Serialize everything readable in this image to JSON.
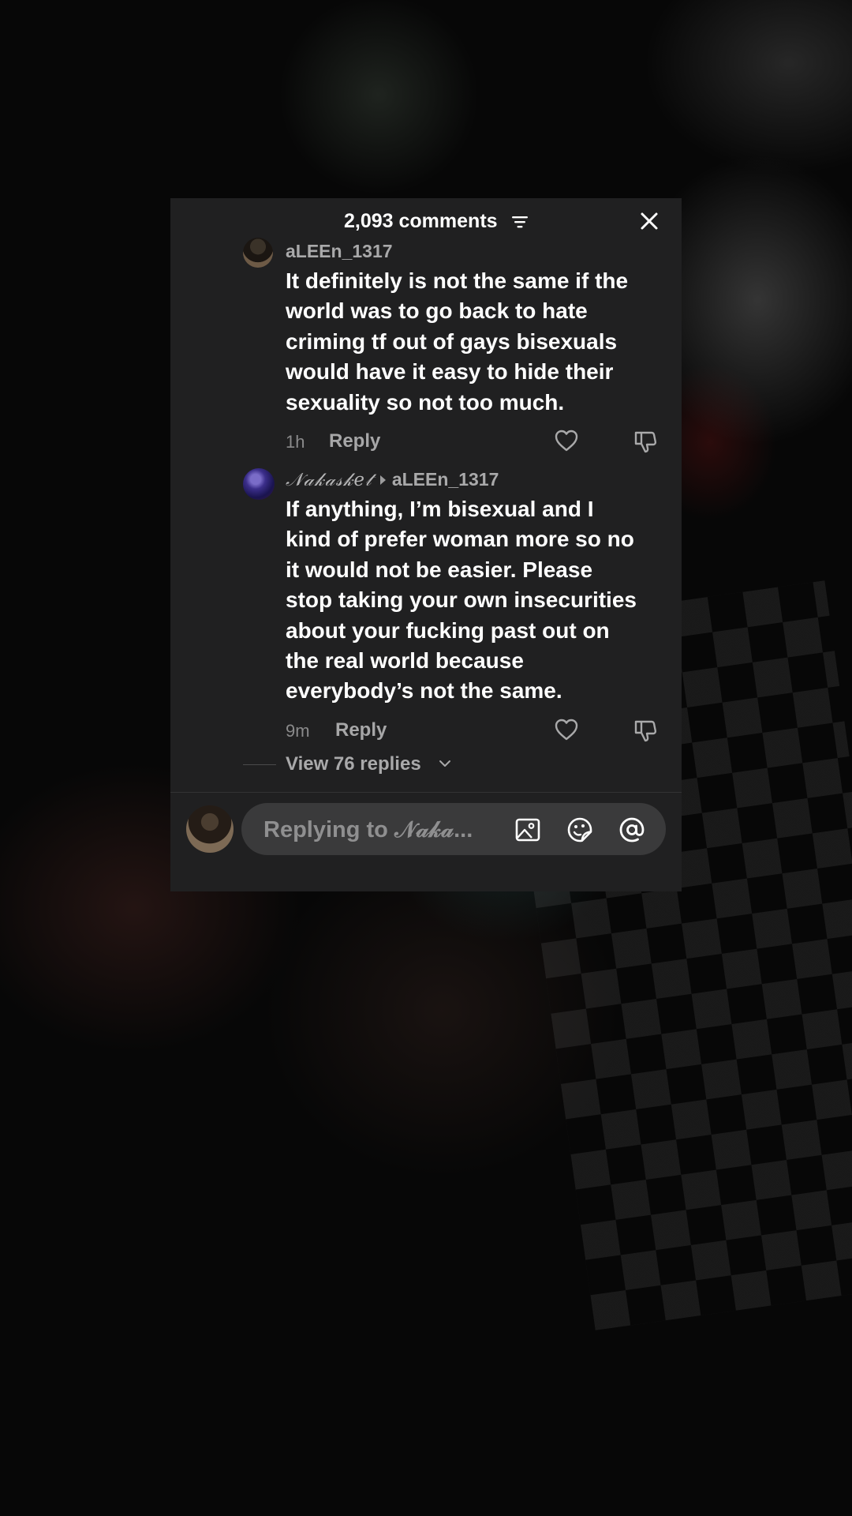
{
  "header": {
    "comment_count": "2,093 comments"
  },
  "icons": {
    "filter": "filter-icon",
    "close": "close-icon",
    "like": "heart-icon",
    "dislike": "thumbs-down-icon",
    "image": "image-icon",
    "sticker": "sticker-icon",
    "mention": "at-icon"
  },
  "comments": [
    {
      "username": "aLEEn_1317",
      "text_lines": [
        "It definitely is not the same if the",
        "world was to go back to hate",
        "criming tf out of gays bisexuals",
        "would have it easy to hide their",
        "sexuality so not too much."
      ],
      "time": "1h",
      "reply_label": "Reply"
    },
    {
      "username": "𝒩𝒶𝓀𝒶𝓈𝓀𝑒𝓉",
      "reply_to": "aLEEn_1317",
      "text_lines": [
        "If anything, I’m bisexual and I",
        "kind of prefer woman more so no",
        "it would not be easier. Please",
        "stop taking your own insecurities",
        "about your fucking past out on",
        "the real world because",
        "everybody’s not the same."
      ],
      "time": "9m",
      "reply_label": "Reply"
    }
  ],
  "view_replies": {
    "label": "View 76 replies"
  },
  "input": {
    "placeholder": "Replying to 𝒩𝒶𝓀𝒶..."
  },
  "colors": {
    "panel": "#202021",
    "text": "#ffffff",
    "muted": "#a9a9aa",
    "input_bg": "#3a3a3b"
  }
}
